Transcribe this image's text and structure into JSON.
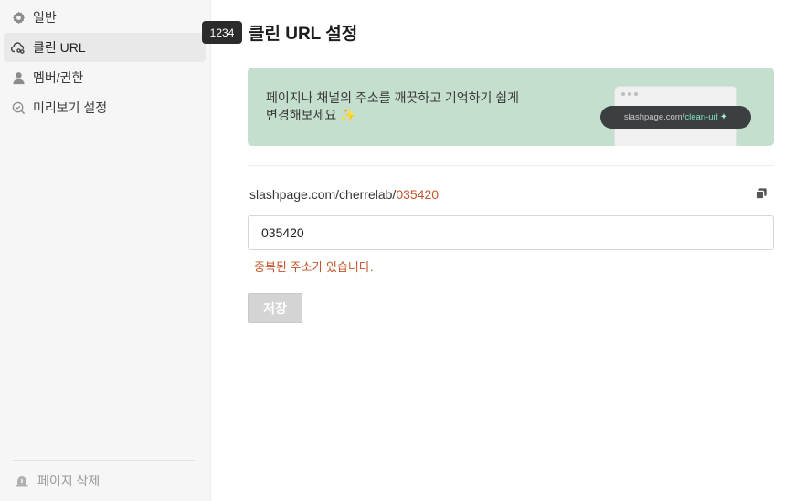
{
  "sidebar": {
    "items": [
      {
        "label": "일반",
        "icon": "gear-icon"
      },
      {
        "label": "클린 URL",
        "icon": "cloud-link-icon"
      },
      {
        "label": "멤버/권한",
        "icon": "person-icon"
      },
      {
        "label": "미리보기 설정",
        "icon": "preview-search-icon"
      }
    ],
    "active_index": 1,
    "delete_label": "페이지 삭제"
  },
  "tooltip": "1234",
  "page_title": "클린 URL 설정",
  "banner": {
    "line1": "페이지나 채널의 주소를 깨끗하고 기억하기 쉽게",
    "line2": "변경해보세요",
    "sparkle": "✨",
    "pill_prefix": "slashpage.com/",
    "pill_clean": "clean-url",
    "pill_star": "✦"
  },
  "url": {
    "base": "slashpage.com/cherrelab/",
    "slug": "035420"
  },
  "input": {
    "value": "035420"
  },
  "error": "중복된 주소가 있습니다.",
  "save_label": "저장",
  "colors": {
    "banner_bg": "#c5dfcf",
    "error": "#c2552a",
    "sidebar_bg": "#f6f6f6",
    "pill_bg": "#3c3f41",
    "pill_accent": "#7fe3c6"
  }
}
